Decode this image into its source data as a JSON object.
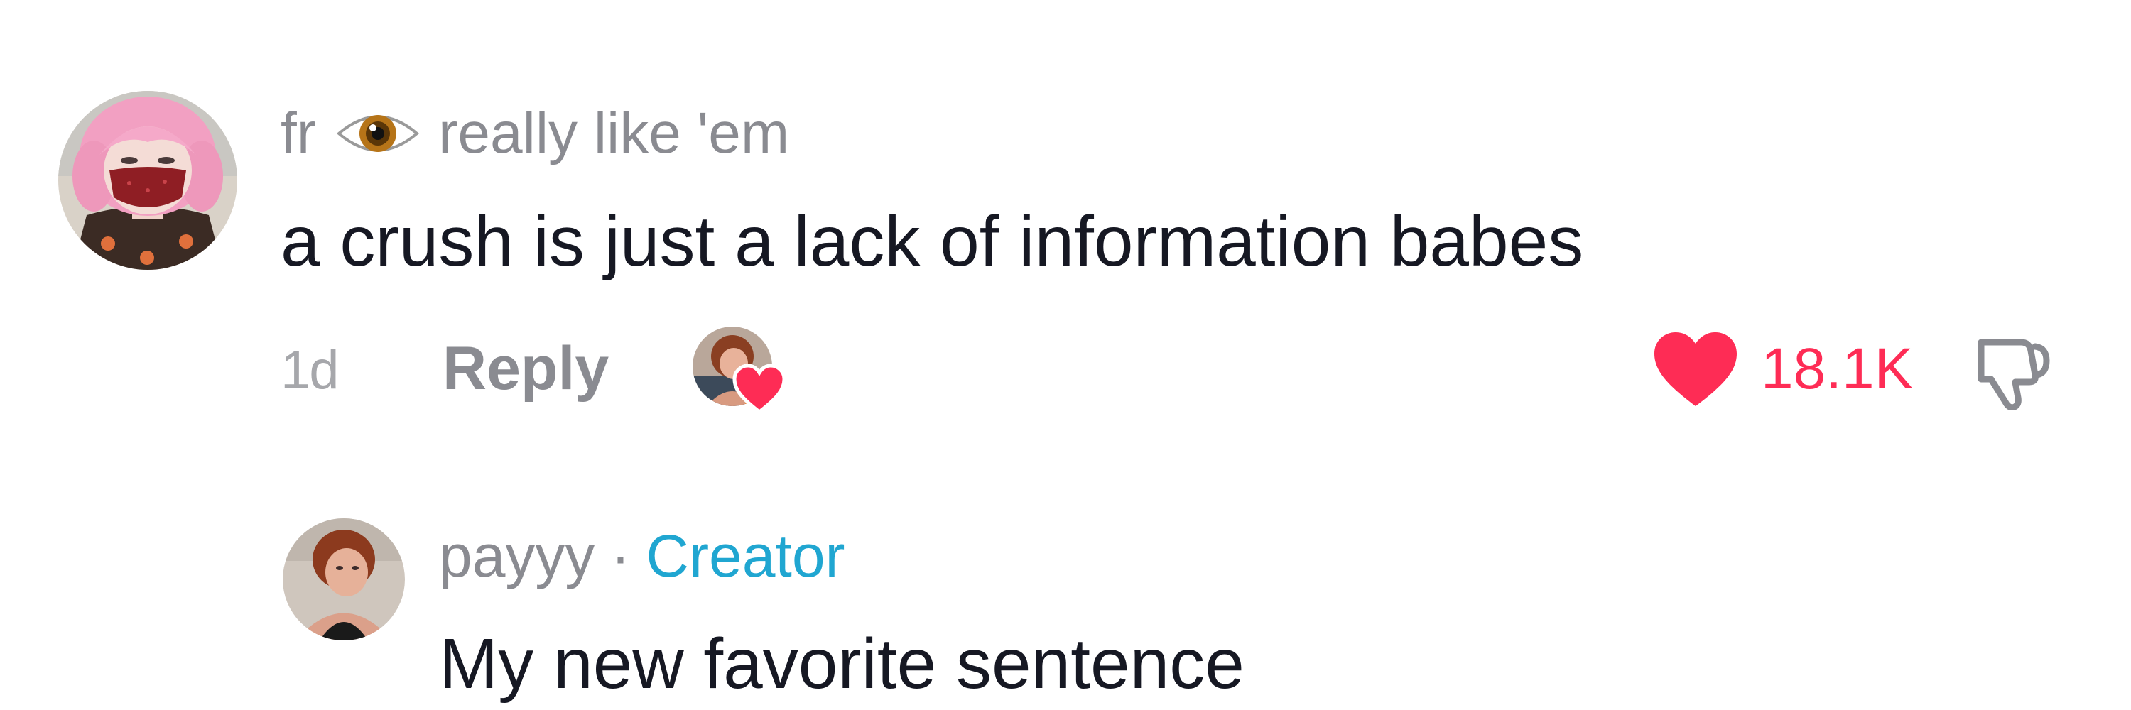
{
  "comment": {
    "username_part1": "fr",
    "username_emoji": "eye-emoji",
    "username_part2": "really like 'em",
    "text": "a crush is just a lack of information babes",
    "timestamp": "1d",
    "reply_label": "Reply",
    "creator_liked_icon": "heart-icon",
    "like_icon": "heart-icon",
    "like_count": "18.1K",
    "dislike_icon": "thumbs-down-icon",
    "colors": {
      "like": "#fe2c55",
      "meta_text": "#8a8b91",
      "body_text": "#161823"
    }
  },
  "reply": {
    "username": "payyy",
    "separator": "·",
    "badge": "Creator",
    "text": "My new favorite sentence",
    "colors": {
      "badge": "#20a6d1"
    }
  }
}
